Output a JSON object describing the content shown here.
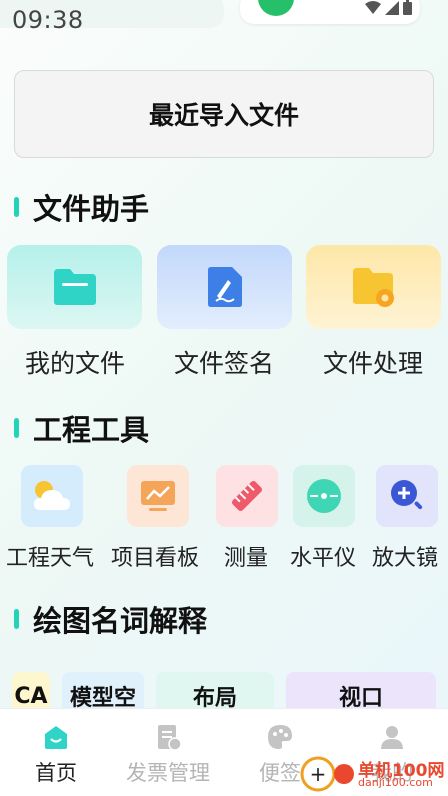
{
  "status_bar": {
    "time": "09:38"
  },
  "recent": {
    "label": "最近导入文件"
  },
  "sections": {
    "file_helper": "文件助手",
    "engineering_tools": "工程工具",
    "glossary": "绘图名词解释"
  },
  "file_helper_items": [
    {
      "label": "我的文件",
      "icon": "folder-icon"
    },
    {
      "label": "文件签名",
      "icon": "signature-icon"
    },
    {
      "label": "文件处理",
      "icon": "folder-gear-icon"
    }
  ],
  "tools": [
    {
      "label": "工程天气",
      "icon": "weather-icon"
    },
    {
      "label": "项目看板",
      "icon": "board-icon"
    },
    {
      "label": "测量",
      "icon": "ruler-icon"
    },
    {
      "label": "水平仪",
      "icon": "level-icon"
    },
    {
      "label": "放大镜",
      "icon": "magnifier-icon"
    }
  ],
  "glossary_items": [
    {
      "label": "CA"
    },
    {
      "label": "模型空"
    },
    {
      "label": "布局"
    },
    {
      "label": "视口"
    }
  ],
  "nav": [
    {
      "label": "首页",
      "active": true
    },
    {
      "label": "发票管理",
      "active": false
    },
    {
      "label": "便签",
      "active": false
    },
    {
      "label": "我的",
      "active": false
    }
  ],
  "watermark": {
    "text": "单机100网",
    "url": "danji100.com"
  },
  "colors": {
    "accent": "#22d3b8",
    "folder_teal": "#2fd4c6",
    "sign_blue": "#3d7fe6",
    "folder_yellow": "#f7c531"
  }
}
